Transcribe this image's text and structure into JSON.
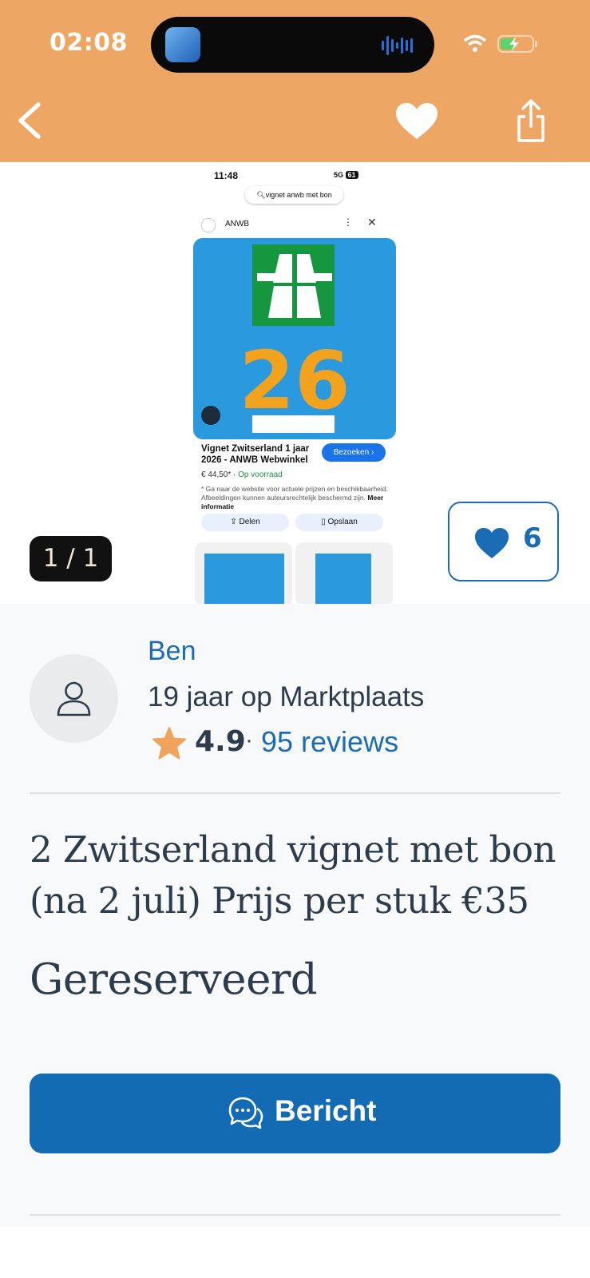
{
  "status_bar": {
    "time": "02:08"
  },
  "header": {
    "back": "chevron-left-icon",
    "favorite": "heart-icon",
    "share": "share-icon"
  },
  "screenshot": {
    "time": "11:48",
    "network": "5G",
    "battery": "61",
    "search_query": "vignet anwb met bon",
    "source": "ANWB",
    "vignette_number": "26",
    "product_title": "Vignet Zwitserland 1 jaar 2026 - ANWB Webwinkel",
    "visit_button": "Bezoeken ›",
    "price": "€ 44,50* ·",
    "stock": "Op voorraad",
    "disclaimer": "* Ga naar de website voor actuele prijzen en beschikbaarheid. Afbeeldingen kunnen auteursrechtelijk beschermd zijn.",
    "more_info": "Meer informatie",
    "share_button": "Delen",
    "save_button": "Opslaan"
  },
  "gallery": {
    "counter": "1 / 1",
    "likes": "6"
  },
  "seller": {
    "name": "Ben",
    "years": "19 jaar op Marktplaats",
    "rating": "4.9",
    "separator": "·",
    "reviews": "95 reviews"
  },
  "listing": {
    "title": "2 Zwitserland vignet met bon (na 2 juli) Prijs per stuk €35",
    "status": "Gereserveerd"
  },
  "actions": {
    "message_button": "Bericht"
  },
  "colors": {
    "header": "#eda663",
    "brand_blue": "#1a6db5",
    "button_blue": "#126bb3",
    "star": "#f0a35a"
  }
}
